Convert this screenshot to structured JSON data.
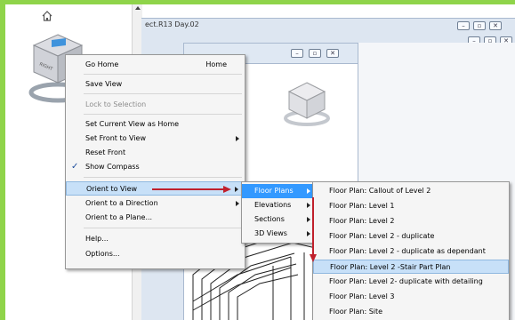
{
  "window": {
    "title_fragment": "ect.R13 Day.02"
  },
  "viewcube": {
    "left_face": "RIGHT",
    "top_face": "TOP"
  },
  "context_menu": {
    "items": [
      {
        "label": "Go Home",
        "shortcut": "Home"
      },
      {
        "label": "Save View"
      },
      {
        "label": "Lock to Selection",
        "disabled": true
      },
      {
        "label": "Set Current View as Home"
      },
      {
        "label": "Set Front to View",
        "submenu": true
      },
      {
        "label": "Reset Front"
      },
      {
        "label": "Show Compass",
        "checked": true
      },
      {
        "label": "Orient to View",
        "submenu": true,
        "highlighted": true
      },
      {
        "label": "Orient to a Direction",
        "submenu": true
      },
      {
        "label": "Orient to a Plane..."
      },
      {
        "label": "Help..."
      },
      {
        "label": "Options..."
      }
    ]
  },
  "view_submenu": {
    "items": [
      {
        "label": "Floor Plans",
        "submenu": true,
        "highlighted": true
      },
      {
        "label": "Elevations",
        "submenu": true
      },
      {
        "label": "Sections",
        "submenu": true
      },
      {
        "label": "3D Views",
        "submenu": true
      }
    ]
  },
  "floor_plans_submenu": {
    "items": [
      {
        "label": "Floor Plan: Callout of Level 2"
      },
      {
        "label": "Floor Plan: Level 1"
      },
      {
        "label": "Floor Plan: Level 2"
      },
      {
        "label": "Floor Plan: Level 2 - duplicate"
      },
      {
        "label": "Floor Plan: Level 2 - duplicate as dependant"
      },
      {
        "label": "Floor Plan: Level 2 -Stair Part Plan",
        "highlighted": true
      },
      {
        "label": "Floor Plan: Level 2- duplicate with detailing"
      },
      {
        "label": "Floor Plan: Level 3"
      },
      {
        "label": "Floor Plan: Site"
      }
    ]
  },
  "colors": {
    "frame": "#8fd44a",
    "highlight": "#3399ff",
    "arrow": "#c0202c"
  }
}
